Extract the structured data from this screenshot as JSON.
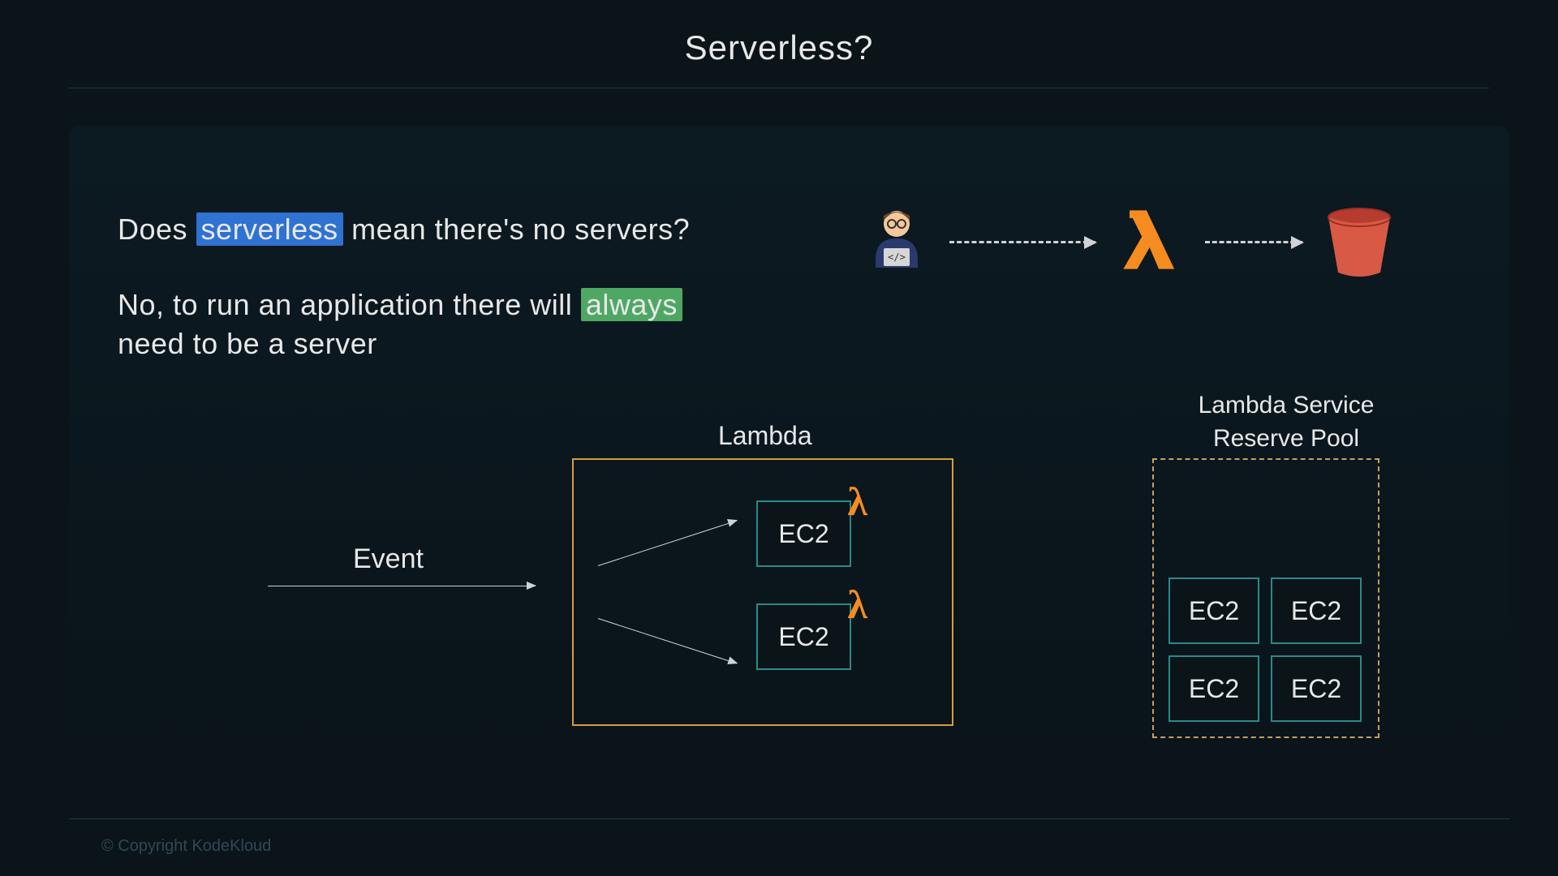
{
  "title": "Serverless?",
  "question": {
    "pre": "Does ",
    "highlight": "serverless",
    "post": " mean there's no servers?"
  },
  "answer": {
    "pre": "No, to run an application there will ",
    "highlight": "always",
    "post": " need to be a server"
  },
  "flow": {
    "developer": "developer-icon",
    "lambda": "lambda-icon",
    "bucket": "s3-bucket-icon"
  },
  "event_label": "Event",
  "lambda_label": "Lambda",
  "lambda_instances": [
    "EC2",
    "EC2"
  ],
  "pool_label_line1": "Lambda Service",
  "pool_label_line2": "Reserve Pool",
  "pool_instances": [
    "EC2",
    "EC2",
    "EC2",
    "EC2"
  ],
  "footer": "© Copyright KodeKloud"
}
